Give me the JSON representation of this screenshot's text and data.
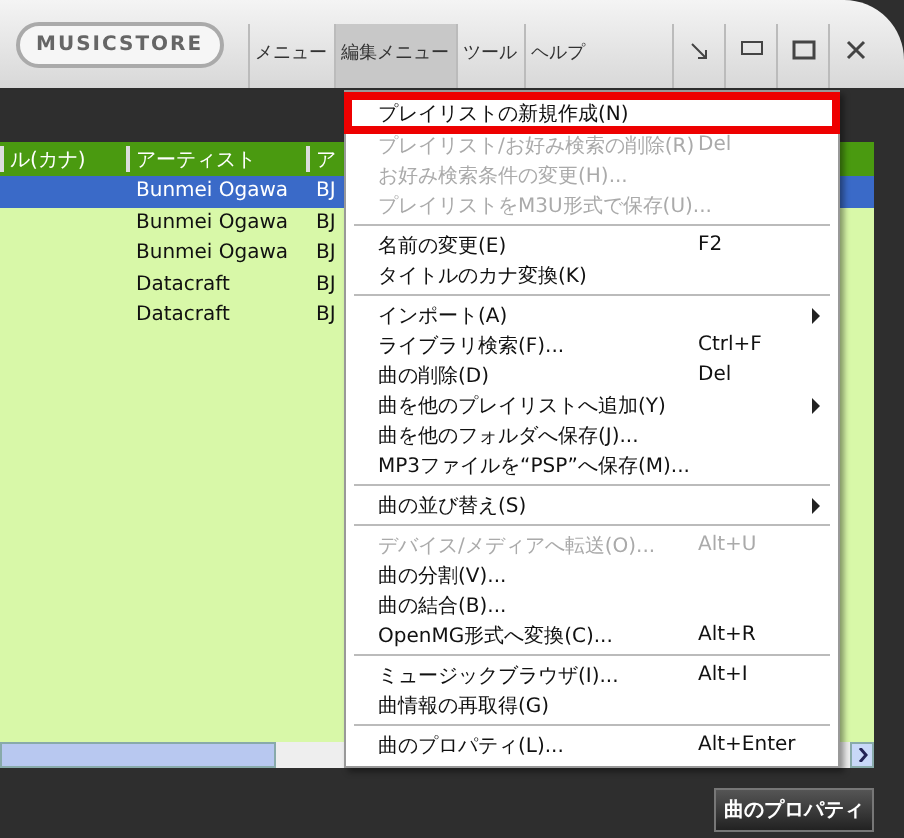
{
  "app": {
    "logo": "MUSICSTORE"
  },
  "menubar": [
    {
      "label": "メニュー",
      "selected": false
    },
    {
      "label": "編集メニュー",
      "selected": true
    },
    {
      "label": "ツール",
      "selected": false
    },
    {
      "label": "ヘルプ",
      "selected": false
    }
  ],
  "window_controls": [
    {
      "kind": "compact"
    },
    {
      "kind": "mini"
    },
    {
      "kind": "maximize"
    },
    {
      "kind": "close"
    }
  ],
  "table": {
    "columns": [
      "ル(カナ)",
      "アーティスト",
      "ア"
    ],
    "rows": [
      {
        "column_2": "Bunmei Ogawa",
        "column_3": "BJ",
        "selected": true
      },
      {
        "column_2": "Bunmei Ogawa",
        "column_3": "BJ",
        "selected": false
      },
      {
        "column_2": "Bunmei Ogawa",
        "column_3": "BJ",
        "selected": false
      },
      {
        "column_2": "Datacraft",
        "column_3": "BJ",
        "selected": false
      },
      {
        "column_2": "Datacraft",
        "column_3": "BJ",
        "selected": false
      }
    ]
  },
  "context_menu": [
    {
      "kind": "item",
      "label": "プレイリストの新規作成(N)",
      "selected": true,
      "disabled": false
    },
    {
      "kind": "item",
      "label": "プレイリスト/お好み検索の削除(R)",
      "shortcut": "Del",
      "selected": false,
      "disabled": true
    },
    {
      "kind": "item",
      "label": "お好み検索条件の変更(H)...",
      "selected": false,
      "disabled": true
    },
    {
      "kind": "item",
      "label": "プレイリストをM3U形式で保存(U)...",
      "selected": false,
      "disabled": true
    },
    {
      "kind": "separator"
    },
    {
      "kind": "item",
      "label": "名前の変更(E)",
      "shortcut": "F2",
      "selected": false,
      "disabled": false
    },
    {
      "kind": "item",
      "label": "タイトルのカナ変換(K)",
      "selected": false,
      "disabled": false
    },
    {
      "kind": "separator"
    },
    {
      "kind": "item",
      "label": "インポート(A)",
      "submenu": true,
      "selected": false,
      "disabled": false
    },
    {
      "kind": "item",
      "label": "ライブラリ検索(F)...",
      "shortcut": "Ctrl+F",
      "selected": false,
      "disabled": false
    },
    {
      "kind": "item",
      "label": "曲の削除(D)",
      "shortcut": "Del",
      "selected": false,
      "disabled": false
    },
    {
      "kind": "item",
      "label": "曲を他のプレイリストへ追加(Y)",
      "submenu": true,
      "selected": false,
      "disabled": false
    },
    {
      "kind": "item",
      "label": "曲を他のフォルダへ保存(J)...",
      "selected": false,
      "disabled": false
    },
    {
      "kind": "item",
      "label": "MP3ファイルを“PSP”へ保存(M)...",
      "selected": false,
      "disabled": false
    },
    {
      "kind": "separator"
    },
    {
      "kind": "item",
      "label": "曲の並び替え(S)",
      "submenu": true,
      "selected": false,
      "disabled": false
    },
    {
      "kind": "separator"
    },
    {
      "kind": "item",
      "label": "デバイス/メディアへ転送(O)...",
      "shortcut": "Alt+U",
      "selected": false,
      "disabled": true
    },
    {
      "kind": "item",
      "label": "曲の分割(V)...",
      "selected": false,
      "disabled": false
    },
    {
      "kind": "item",
      "label": "曲の結合(B)...",
      "selected": false,
      "disabled": false
    },
    {
      "kind": "item",
      "label": "OpenMG形式へ変換(C)...",
      "shortcut": "Alt+R",
      "selected": false,
      "disabled": false
    },
    {
      "kind": "separator"
    },
    {
      "kind": "item",
      "label": "ミュージックブラウザ(I)...",
      "shortcut": "Alt+I",
      "selected": false,
      "disabled": false
    },
    {
      "kind": "item",
      "label": "曲情報の再取得(G)",
      "selected": false,
      "disabled": false
    },
    {
      "kind": "separator"
    },
    {
      "kind": "item",
      "label": "曲のプロパティ(L)...",
      "shortcut": "Alt+Enter",
      "selected": false,
      "disabled": false
    }
  ],
  "footer_button": "曲のプロパティ"
}
